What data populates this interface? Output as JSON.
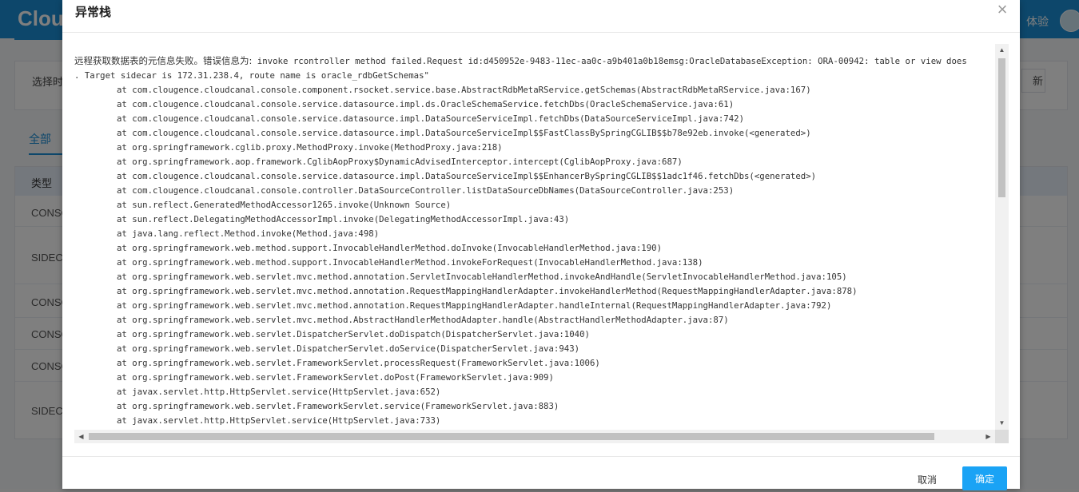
{
  "background": {
    "logo": "Clou",
    "user_label": "体验",
    "filter_label": "选择时",
    "refresh_partial": "新",
    "tab_all": "全部",
    "table_header_type": "类型",
    "rows": [
      "CONSO",
      "SIDECA",
      "CONSO",
      "CONSO",
      "CONSO",
      "SIDECA"
    ]
  },
  "modal": {
    "title": "异常栈",
    "close_symbol": "×",
    "message_zh": "远程获取数据表的元信息失败。错误信息为:",
    "message_en": " invoke rcontroller method failed.Request id:d450952e-9483-11ec-aa0c-a9b401a0b18emsg:OracleDatabaseException: ORA-00942: table or view does",
    "line2": ". Target sidecar is 172.31.238.4, route name is oracle_rdbGetSchemas\"",
    "stack": [
      "at com.clougence.cloudcanal.console.component.rsocket.service.base.AbstractRdbMetaRService.getSchemas(AbstractRdbMetaRService.java:167)",
      "at com.clougence.cloudcanal.console.service.datasource.impl.ds.OracleSchemaService.fetchDbs(OracleSchemaService.java:61)",
      "at com.clougence.cloudcanal.console.service.datasource.impl.DataSourceServiceImpl.fetchDbs(DataSourceServiceImpl.java:742)",
      "at com.clougence.cloudcanal.console.service.datasource.impl.DataSourceServiceImpl$$FastClassBySpringCGLIB$$b78e92eb.invoke(<generated>)",
      "at org.springframework.cglib.proxy.MethodProxy.invoke(MethodProxy.java:218)",
      "at org.springframework.aop.framework.CglibAopProxy$DynamicAdvisedInterceptor.intercept(CglibAopProxy.java:687)",
      "at com.clougence.cloudcanal.console.service.datasource.impl.DataSourceServiceImpl$$EnhancerBySpringCGLIB$$1adc1f46.fetchDbs(<generated>)",
      "at com.clougence.cloudcanal.console.controller.DataSourceController.listDataSourceDbNames(DataSourceController.java:253)",
      "at sun.reflect.GeneratedMethodAccessor1265.invoke(Unknown Source)",
      "at sun.reflect.DelegatingMethodAccessorImpl.invoke(DelegatingMethodAccessorImpl.java:43)",
      "at java.lang.reflect.Method.invoke(Method.java:498)",
      "at org.springframework.web.method.support.InvocableHandlerMethod.doInvoke(InvocableHandlerMethod.java:190)",
      "at org.springframework.web.method.support.InvocableHandlerMethod.invokeForRequest(InvocableHandlerMethod.java:138)",
      "at org.springframework.web.servlet.mvc.method.annotation.ServletInvocableHandlerMethod.invokeAndHandle(ServletInvocableHandlerMethod.java:105)",
      "at org.springframework.web.servlet.mvc.method.annotation.RequestMappingHandlerAdapter.invokeHandlerMethod(RequestMappingHandlerAdapter.java:878)",
      "at org.springframework.web.servlet.mvc.method.annotation.RequestMappingHandlerAdapter.handleInternal(RequestMappingHandlerAdapter.java:792)",
      "at org.springframework.web.servlet.mvc.method.AbstractHandlerMethodAdapter.handle(AbstractHandlerMethodAdapter.java:87)",
      "at org.springframework.web.servlet.DispatcherServlet.doDispatch(DispatcherServlet.java:1040)",
      "at org.springframework.web.servlet.DispatcherServlet.doService(DispatcherServlet.java:943)",
      "at org.springframework.web.servlet.FrameworkServlet.processRequest(FrameworkServlet.java:1006)",
      "at org.springframework.web.servlet.FrameworkServlet.doPost(FrameworkServlet.java:909)",
      "at javax.servlet.http.HttpServlet.service(HttpServlet.java:652)",
      "at org.springframework.web.servlet.FrameworkServlet.service(FrameworkServlet.java:883)",
      "at javax.servlet.http.HttpServlet.service(HttpServlet.java:733)"
    ],
    "cancel_label": "取消",
    "ok_label": "确定"
  },
  "colors": {
    "brand": "#1b8fd6",
    "primary_button": "#1aa3f5"
  }
}
